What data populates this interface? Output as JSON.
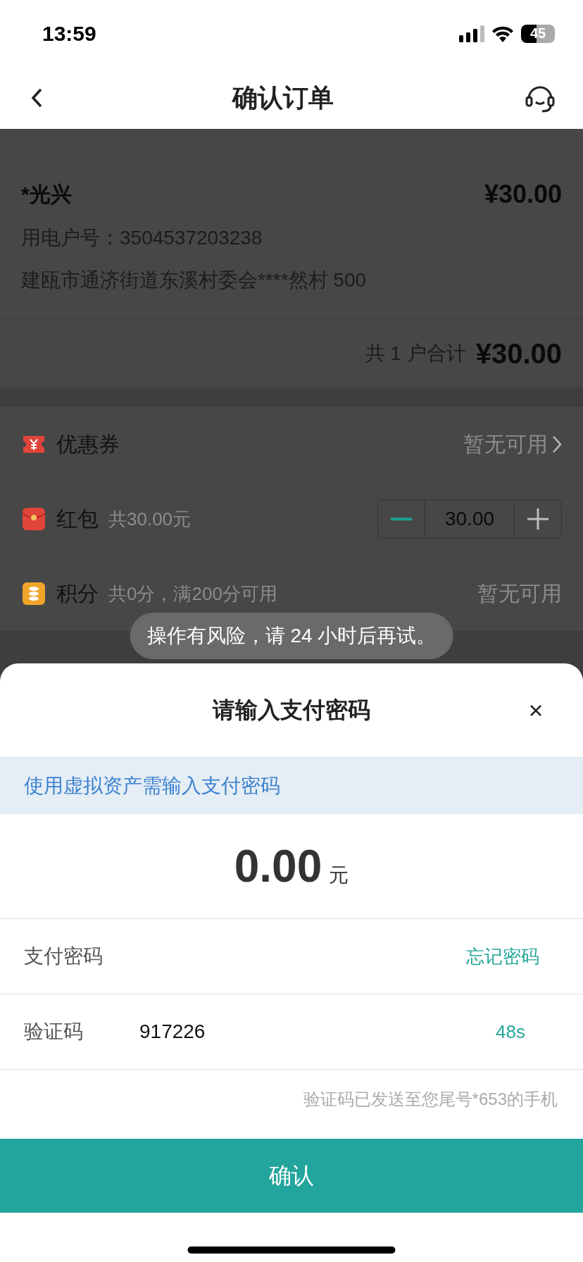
{
  "status_bar": {
    "time": "13:59",
    "battery": "45"
  },
  "nav": {
    "title": "确认订单"
  },
  "order": {
    "name": "*光兴",
    "price": "¥30.00",
    "account": "用电户号：3504537203238",
    "address": "建瓯市通济街道东溪村委会****然村 500"
  },
  "total": {
    "label": "共 1 户合计",
    "amount": "¥30.00"
  },
  "discounts": [
    {
      "kind": "coupon",
      "label": "优惠券",
      "value": "暂无可用"
    },
    {
      "kind": "stepper",
      "label": "红包",
      "note": "共30.00元",
      "value": "30.00"
    },
    {
      "kind": "points",
      "label": "积分",
      "note": "共0分，满200分可用",
      "value": "暂无可用"
    }
  ],
  "toast": "操作有风险，请 24 小时后再试。",
  "dialog": {
    "title": "请输入支付密码",
    "banner": "使用虚拟资产需输入支付密码",
    "amount": "0.00",
    "unit": "元",
    "password_label": "支付密码",
    "forgot": "忘记密码",
    "code_label": "验证码",
    "code_value": "917226",
    "countdown": "48s",
    "hint": "验证码已发送至您尾号*653的手机",
    "confirm": "确认"
  }
}
